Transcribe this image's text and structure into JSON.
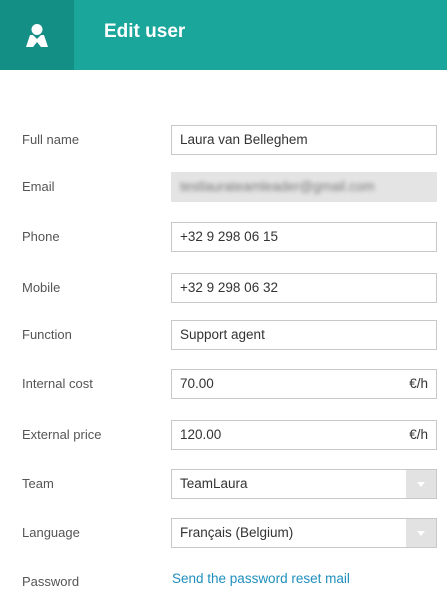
{
  "header": {
    "title": "Edit user",
    "icon": "user-icon",
    "bg_color": "#1aa69b",
    "icon_bg_color": "#148f86"
  },
  "form": {
    "full_name": {
      "label": "Full name",
      "value": "Laura van Belleghem"
    },
    "email": {
      "label": "Email",
      "value": "testlaurateamleader@gmail.com"
    },
    "phone": {
      "label": "Phone",
      "value": "+32 9 298 06 15"
    },
    "mobile": {
      "label": "Mobile",
      "value": "+32 9 298 06 32"
    },
    "function": {
      "label": "Function",
      "value": "Support agent"
    },
    "internal_cost": {
      "label": "Internal cost",
      "value": "70.00",
      "unit": "€/h"
    },
    "external_price": {
      "label": "External price",
      "value": "120.00",
      "unit": "€/h"
    },
    "team": {
      "label": "Team",
      "value": "TeamLaura"
    },
    "language": {
      "label": "Language",
      "value": "Français (Belgium)"
    },
    "password": {
      "label": "Password",
      "link": "Send the password reset mail"
    }
  }
}
